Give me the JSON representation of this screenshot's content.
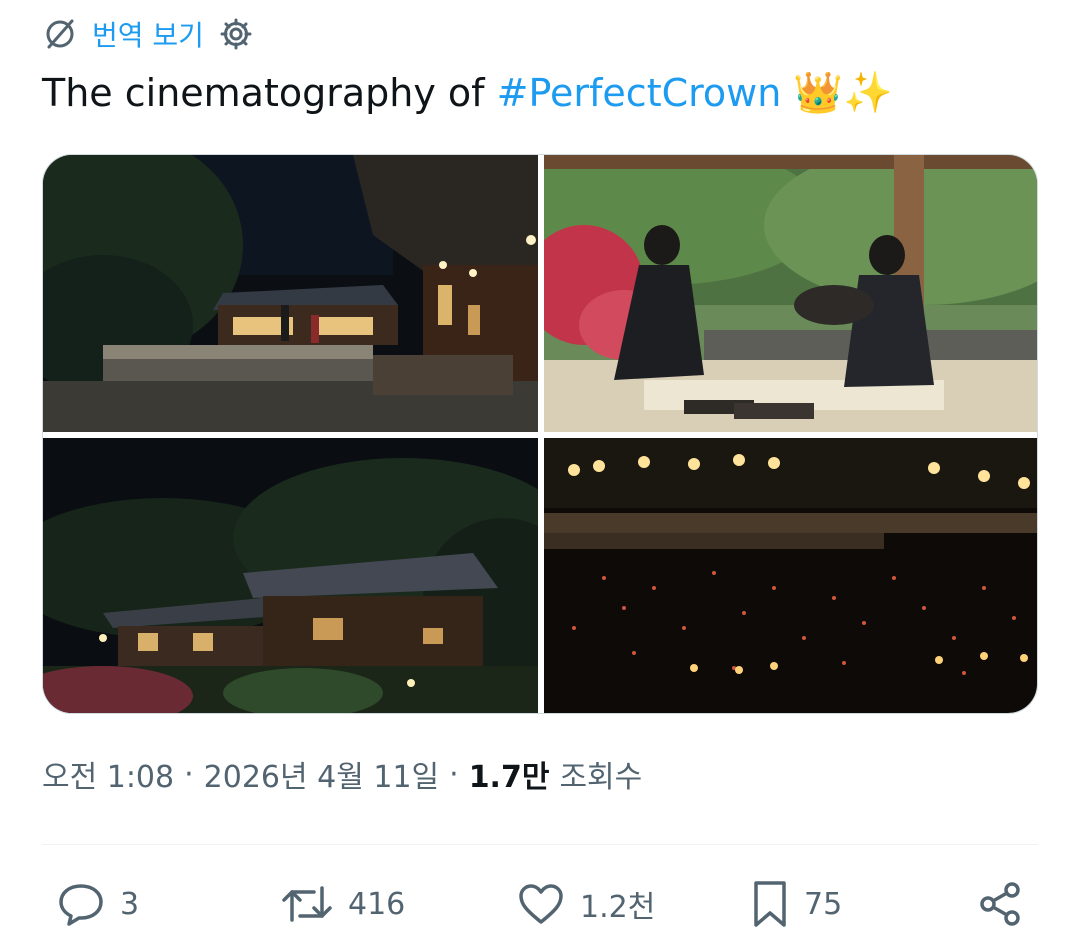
{
  "translate": {
    "label": "번역 보기"
  },
  "tweet": {
    "text_prefix": "The cinematography of ",
    "hashtag": "#PerfectCrown",
    "emojis": "👑✨"
  },
  "media": {
    "photos": [
      {
        "name": "night-palace-courtyard"
      },
      {
        "name": "pavilion-calligraphy-scene"
      },
      {
        "name": "night-hanok-garden"
      },
      {
        "name": "lantern-pond-night"
      }
    ]
  },
  "meta": {
    "time": "오전 1:08",
    "separator": "·",
    "date": "2026년 4월 11일",
    "views_count": "1.7만",
    "views_label": "조회수"
  },
  "actions": {
    "reply_count": "3",
    "retweet_count": "416",
    "like_count": "1.2천",
    "bookmark_count": "75"
  },
  "icons": {
    "translate": "translate-globe-icon",
    "settings": "gear-icon",
    "reply": "speech-bubble-icon",
    "retweet": "retweet-arrows-icon",
    "like": "heart-icon",
    "bookmark": "bookmark-icon",
    "share": "share-nodes-icon"
  },
  "colors": {
    "accent": "#1d9bf0",
    "secondary_text": "#536471",
    "primary_text": "#0f1419"
  }
}
